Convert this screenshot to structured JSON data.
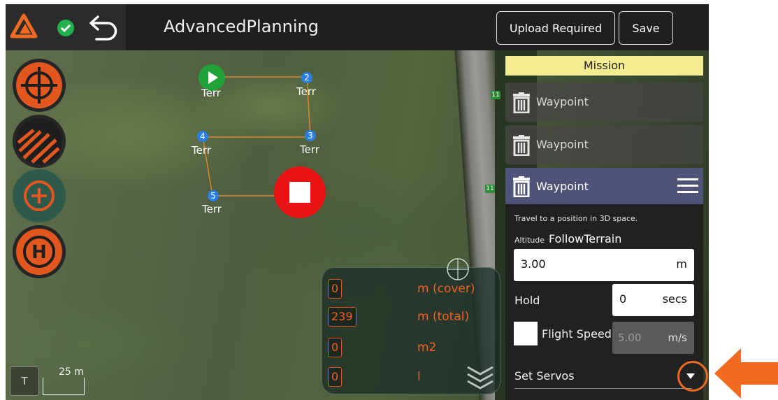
{
  "topbar": {
    "title": "AdvancedPlanning",
    "upload_label": "Upload Required",
    "save_label": "Save"
  },
  "tools": [
    "target-icon",
    "survey-icon",
    "add-waypoint-icon",
    "home-icon"
  ],
  "map": {
    "waypoints": [
      {
        "num": "2",
        "label": "Terr"
      },
      {
        "num": "3",
        "label": "Terr"
      },
      {
        "num": "4",
        "label": "Terr"
      },
      {
        "num": "5",
        "label": "Terr"
      }
    ],
    "start_label": "Terr",
    "road_sign_1": "11",
    "road_sign_2": "11",
    "scale_label": "25 m",
    "t_label": "T"
  },
  "stats": [
    {
      "value": "0",
      "unit": "m (cover)"
    },
    {
      "value": "239",
      "unit": "m (total)"
    },
    {
      "value": "0",
      "unit": "m2"
    },
    {
      "value": "0",
      "unit": "l"
    }
  ],
  "mission": {
    "tab_label": "Mission",
    "items": [
      {
        "label": "Waypoint"
      },
      {
        "label": "Waypoint"
      },
      {
        "label": "Waypoint"
      }
    ],
    "detail": {
      "description": "Travel to a position in 3D space.",
      "altitude_label": "Altitude",
      "altitude_mode": "FollowTerrain",
      "altitude_value": "3.00",
      "altitude_unit": "m",
      "hold_label": "Hold",
      "hold_value": "0",
      "hold_unit": "secs",
      "flight_speed_label": "Flight Speed",
      "flight_speed_value": "5.00",
      "flight_speed_unit": "m/s",
      "servos_label": "Set Servos"
    }
  },
  "colors": {
    "accent": "#f06a21",
    "stop": "#e81414",
    "mission_tab": "#f4ec90",
    "active_row": "#505378",
    "waypoint_marker": "#2a7ee8"
  }
}
